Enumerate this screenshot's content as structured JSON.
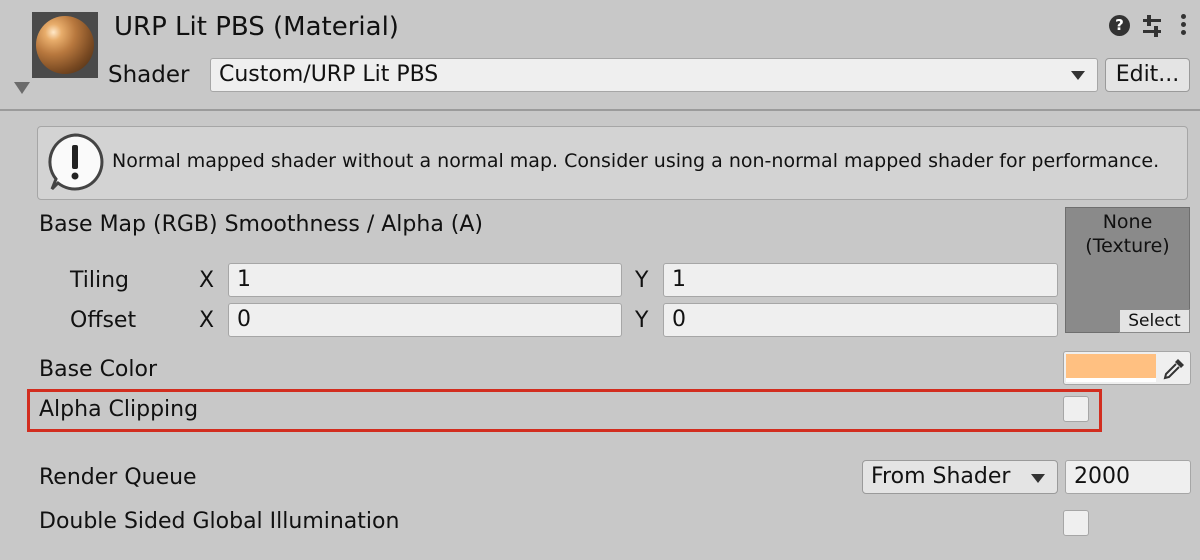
{
  "header": {
    "title": "URP Lit PBS (Material)",
    "shader_label": "Shader",
    "shader_value": "Custom/URP Lit PBS",
    "edit_button": "Edit...",
    "help_icon_glyph": "?"
  },
  "helpbox": {
    "icon": "warning-icon",
    "message": "Normal mapped shader without a normal map. Consider using a non-normal mapped shader for performance."
  },
  "base_map": {
    "label": "Base Map (RGB) Smoothness / Alpha (A)",
    "texture_none": "None",
    "texture_type": "(Texture)",
    "select_button": "Select",
    "tiling": {
      "label": "Tiling",
      "x_label": "X",
      "x": "1",
      "y_label": "Y",
      "y": "1"
    },
    "offset": {
      "label": "Offset",
      "x_label": "X",
      "x": "0",
      "y_label": "Y",
      "y": "0"
    }
  },
  "base_color": {
    "label": "Base Color",
    "color": "#ffc081"
  },
  "alpha_clipping": {
    "label": "Alpha Clipping",
    "checked": false,
    "highlight_color": "#d22d1f"
  },
  "render_queue": {
    "label": "Render Queue",
    "mode": "From Shader",
    "value": "2000"
  },
  "double_sided_gi": {
    "label": "Double Sided Global Illumination",
    "checked": false
  }
}
